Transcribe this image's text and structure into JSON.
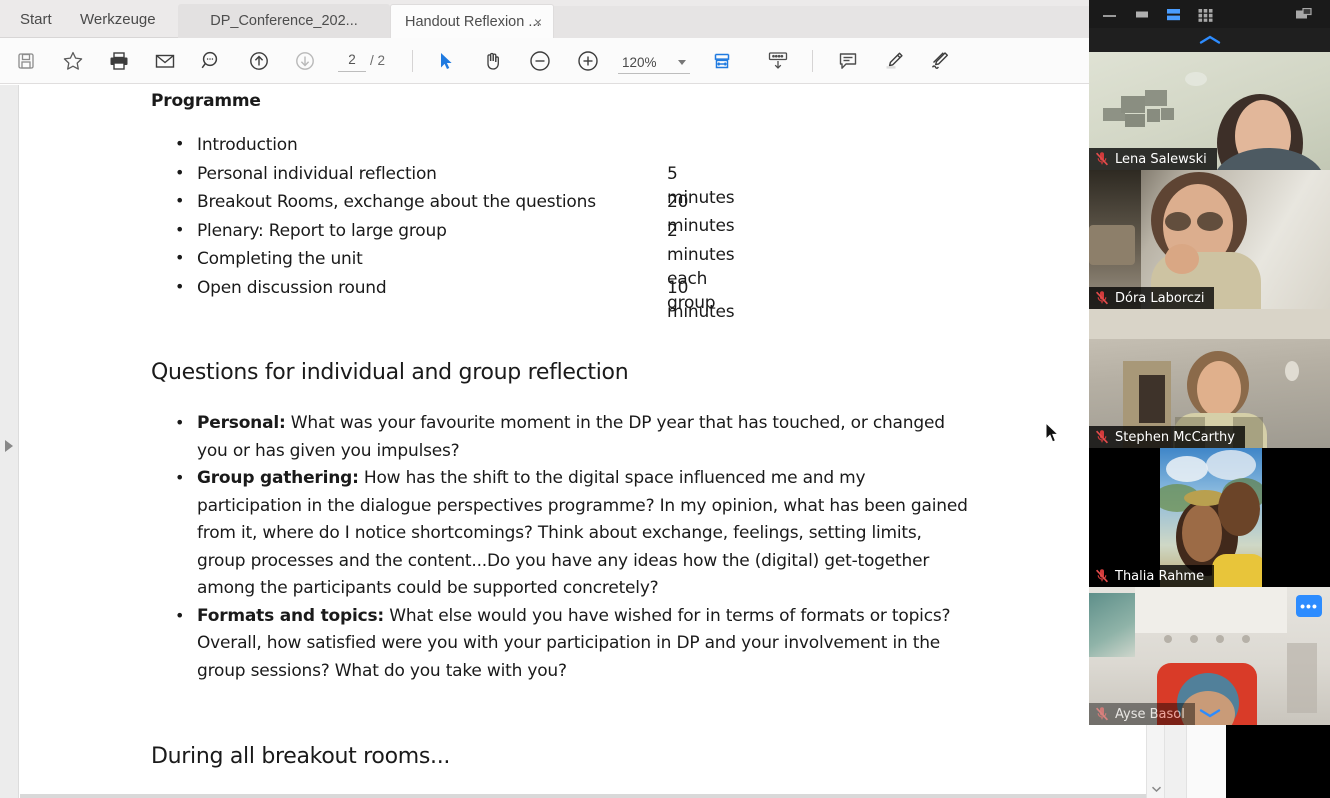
{
  "app": {
    "menu": {
      "start": "Start",
      "tools": "Werkzeuge"
    },
    "tabs": [
      {
        "label": "DP_Conference_202...",
        "active": false
      },
      {
        "label": "Handout Reflexion ...",
        "active": true,
        "close": "×"
      }
    ]
  },
  "toolbar": {
    "icons": [
      {
        "name": "save-icon",
        "title": "Save"
      },
      {
        "name": "star-icon",
        "title": "Add to favorites"
      },
      {
        "name": "print-icon",
        "title": "Print"
      },
      {
        "name": "email-icon",
        "title": "Email"
      },
      {
        "name": "search-icon",
        "title": "Search"
      },
      {
        "name": "page-up-icon",
        "title": "Previous page"
      },
      {
        "name": "page-down-icon",
        "title": "Next page"
      },
      {
        "name": "select-cursor-icon",
        "title": "Select tool"
      },
      {
        "name": "hand-pan-icon",
        "title": "Hand tool"
      },
      {
        "name": "zoom-out-icon",
        "title": "Zoom out"
      },
      {
        "name": "zoom-in-icon",
        "title": "Zoom in"
      },
      {
        "name": "fit-page-icon",
        "title": "Fit page"
      },
      {
        "name": "keyboard-icon",
        "title": "Keyboard"
      },
      {
        "name": "comment-icon",
        "title": "Comment"
      },
      {
        "name": "highlight-pen-icon",
        "title": "Highlight"
      },
      {
        "name": "signature-icon",
        "title": "Signature"
      }
    ],
    "page_current": "2",
    "page_total": "/ 2",
    "zoom_level": "120%"
  },
  "document": {
    "heading_programme": "Programme",
    "programme": [
      {
        "label": "Introduction",
        "duration": ""
      },
      {
        "label": "Personal individual reflection",
        "duration": "5 minutes"
      },
      {
        "label": "Breakout Rooms, exchange about the questions",
        "duration": "20 minutes"
      },
      {
        "label": "Plenary: Report to large group",
        "duration": "2 minutes each group"
      },
      {
        "label": "Completing the unit",
        "duration": ""
      },
      {
        "label": "Open discussion round",
        "duration": "10 minutes"
      }
    ],
    "heading_questions": "Questions for individual and group reflection",
    "questions": [
      {
        "lead": "Personal:",
        "body": " What was your favourite moment in the DP year that has touched, or changed you or has given you impulses?"
      },
      {
        "lead": "Group gathering:",
        "body": " How has the shift to the digital space influenced me and my participation in the dialogue perspectives programme? In my opinion, what has been gained from it, where do I notice shortcomings? Think about exchange, feelings, setting limits, group processes and the content...Do you have any ideas how the (digital) get-together among the participants could be supported concretely?"
      },
      {
        "lead": "Formats and topics:",
        "body": " What else would you have wished for in terms of formats or topics? Overall, how satisfied were you with your participation in DP and your involvement in the group sessions? What do you take with you?"
      }
    ],
    "heading_breakout": "During all breakout rooms..."
  },
  "zoom_meeting": {
    "window_controls": [
      {
        "name": "minimize-icon"
      },
      {
        "name": "maximize-icon"
      },
      {
        "name": "speaker-view-icon",
        "active": true
      },
      {
        "name": "gallery-view-icon"
      },
      {
        "name": "picture-in-picture-icon"
      }
    ],
    "collapse_up_label": "collapse",
    "expand_down_label": "expand",
    "more_options_label": "•••",
    "participants": [
      {
        "name": "Lena Salewski",
        "muted": true
      },
      {
        "name": "Dóra Laborczi",
        "muted": true
      },
      {
        "name": "Stephen McCarthy",
        "muted": true
      },
      {
        "name": "Thalia Rahme",
        "muted": true
      },
      {
        "name": "Ayse Basol",
        "muted": true
      }
    ]
  },
  "colors": {
    "accent_blue": "#2d8cff",
    "toolbar_blue": "#1d6fd0",
    "tabbar_bg": "#eceaea",
    "panel_dark": "#131313"
  }
}
